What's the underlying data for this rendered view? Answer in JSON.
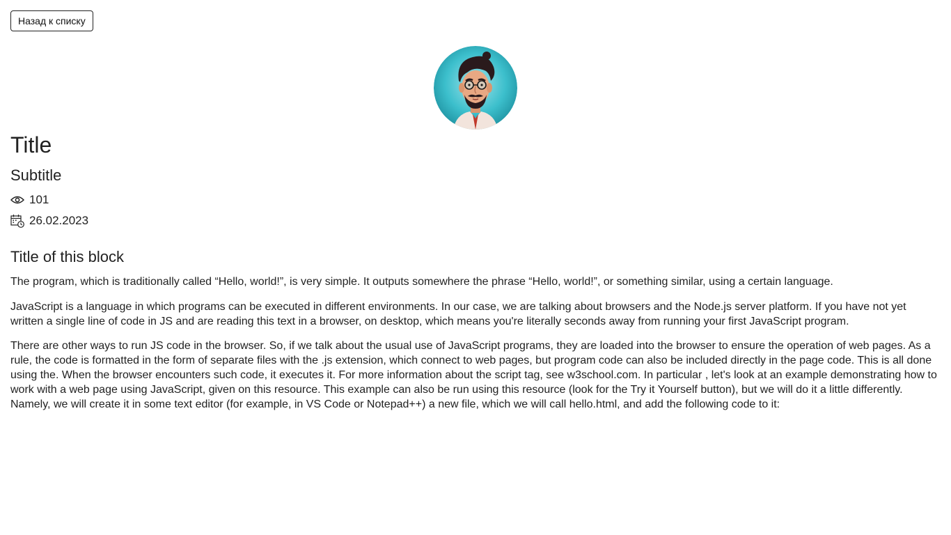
{
  "nav": {
    "back_label": "Назад к списку"
  },
  "article": {
    "title": "Title",
    "subtitle": "Subtitle",
    "views": "101",
    "date": "26.02.2023",
    "block_title": "Title of this block",
    "paragraphs": [
      "The program, which is traditionally called “Hello, world!”, is very simple. It outputs somewhere the phrase “Hello, world!”, or something similar, using a certain language.",
      "JavaScript is a language in which programs can be executed in different environments. In our case, we are talking about browsers and the Node.js server platform. If you have not yet written a single line of code in JS and are reading this text in a browser, on desktop, which means you're literally seconds away from running your first JavaScript program.",
      "There are other ways to run JS code in the browser. So, if we talk about the usual use of JavaScript programs, they are loaded into the browser to ensure the operation of web pages. As a rule, the code is formatted in the form of separate files with the .js extension, which connect to web pages, but program code can also be included directly in the page code. This is all done using the. When the browser encounters such code, it executes it. For more information about the script tag, see w3school.com. In particular , let's look at an example demonstrating how to work with a web page using JavaScript, given on this resource. This example can also be run using this resource (look for the Try it Yourself button), but we will do it a little differently. Namely, we will create it in some text editor (for example, in VS Code or Notepad++) a new file, which we will call hello.html, and add the following code to it:"
    ]
  },
  "icons": {
    "views": "eye-icon",
    "date": "calendar-clock-icon",
    "avatar": "avatar-illustration"
  },
  "colors": {
    "text": "#222222",
    "avatar_bg": "#2bb3c0"
  }
}
